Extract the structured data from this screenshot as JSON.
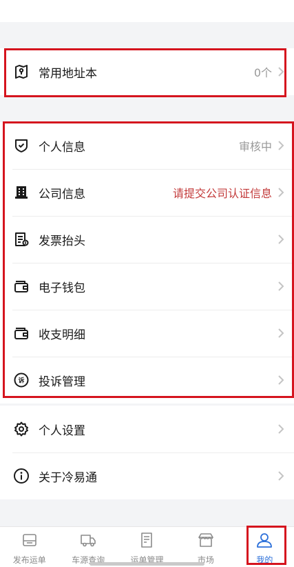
{
  "address_group": {
    "items": [
      {
        "label": "常用地址本",
        "value": "0个",
        "icon": "address-book-icon"
      }
    ]
  },
  "account_group": {
    "items": [
      {
        "label": "个人信息",
        "value": "审核中",
        "icon": "shield-check-icon"
      },
      {
        "label": "公司信息",
        "value": "请提交公司认证信息",
        "icon": "building-icon"
      },
      {
        "label": "发票抬头",
        "value": "",
        "icon": "invoice-icon"
      },
      {
        "label": "电子钱包",
        "value": "",
        "icon": "wallet-icon"
      },
      {
        "label": "收支明细",
        "value": "",
        "icon": "wallet-icon"
      },
      {
        "label": "投诉管理",
        "value": "",
        "icon": "complaint-icon"
      }
    ]
  },
  "settings_group": {
    "items": [
      {
        "label": "个人设置",
        "icon": "gear-icon"
      },
      {
        "label": "关于冷易通",
        "icon": "info-icon"
      }
    ]
  },
  "tabbar": {
    "tabs": [
      {
        "label": "发布运单",
        "icon": "publish-icon"
      },
      {
        "label": "车源查询",
        "icon": "truck-icon"
      },
      {
        "label": "运单管理",
        "icon": "document-icon"
      },
      {
        "label": "市场",
        "icon": "store-icon"
      },
      {
        "label": "我的",
        "icon": "user-icon",
        "active": true
      }
    ]
  },
  "colors": {
    "accent": "#2b6fd9",
    "warning_text": "#c33a3a",
    "highlight_box": "#d5141e",
    "background": "#f3f4f6"
  }
}
